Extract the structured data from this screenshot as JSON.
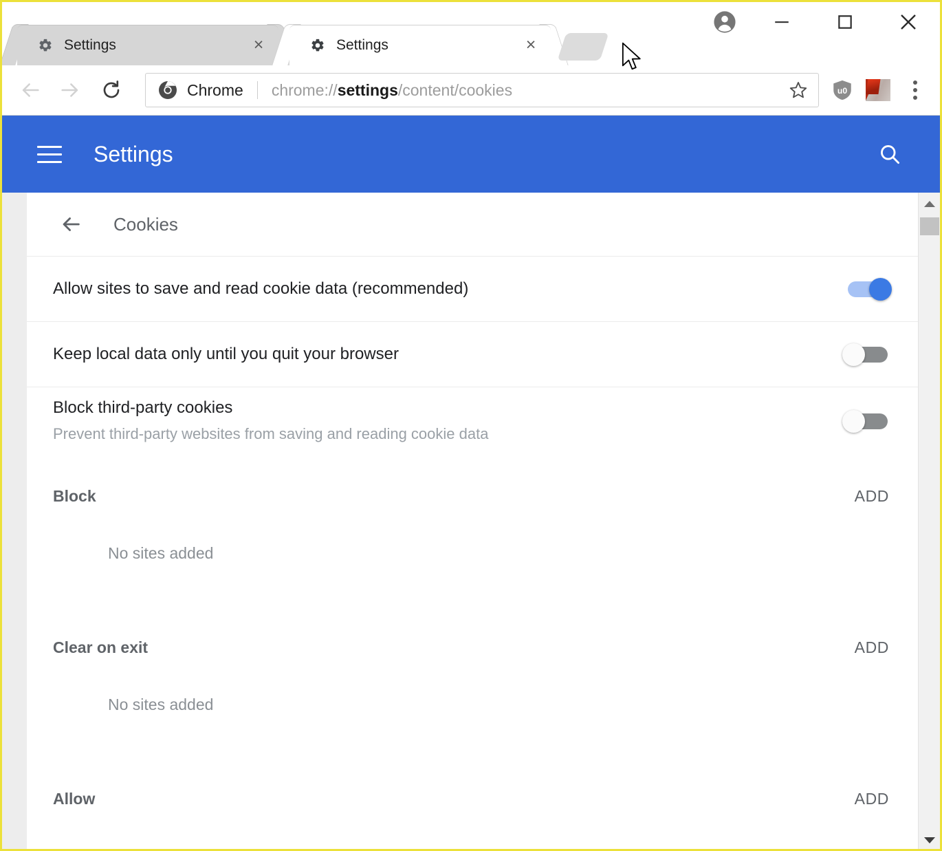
{
  "window": {
    "caption": {
      "avatar": "account-avatar",
      "minimize": "minimize",
      "maximize": "maximize",
      "close": "close"
    }
  },
  "tabs": [
    {
      "title": "Settings",
      "favicon": "gear-icon",
      "close": "×",
      "active": false
    },
    {
      "title": "Settings",
      "favicon": "gear-icon",
      "close": "×",
      "active": true
    }
  ],
  "new_tab_button": "new-tab",
  "toolbar": {
    "back": "back",
    "forward": "forward",
    "reload": "reload",
    "brand_label": "Chrome",
    "url_prefix": "chrome://",
    "url_strong": "settings",
    "url_suffix": "/content/cookies",
    "url_full": "chrome://settings/content/cookies",
    "bookmark_star": "star-icon",
    "extension_ublock": "ublock-origin-icon",
    "extension_image": "image-extension-icon",
    "menu": "three-dot-menu"
  },
  "settings_header": {
    "menu_label": "hamburger-menu",
    "title": "Settings",
    "search_label": "search-icon"
  },
  "page": {
    "back_label": "back-arrow",
    "title": "Cookies",
    "rows": [
      {
        "label": "Allow sites to save and read cookie data (recommended)",
        "sub": "",
        "toggle": "on"
      },
      {
        "label": "Keep local data only until you quit your browser",
        "sub": "",
        "toggle": "off"
      },
      {
        "label": "Block third-party cookies",
        "sub": "Prevent third-party websites from saving and reading cookie data",
        "toggle": "off"
      }
    ],
    "sections": [
      {
        "title": "Block",
        "add_label": "ADD",
        "empty": "No sites added"
      },
      {
        "title": "Clear on exit",
        "add_label": "ADD",
        "empty": "No sites added"
      },
      {
        "title": "Allow",
        "add_label": "ADD",
        "empty": ""
      }
    ]
  },
  "scrollbar": {
    "up": "scroll-up",
    "down": "scroll-down",
    "thumb": "scroll-thumb"
  },
  "colors": {
    "accent_blue": "#3367d6",
    "toggle_on_knob": "#3b7ae4",
    "toggle_on_track": "#a6c2f5",
    "toggle_off_track": "#888b8d",
    "window_border": "#ece13a",
    "text_primary": "#202124",
    "text_secondary": "#5f6368",
    "text_muted": "#9aa0a6"
  }
}
